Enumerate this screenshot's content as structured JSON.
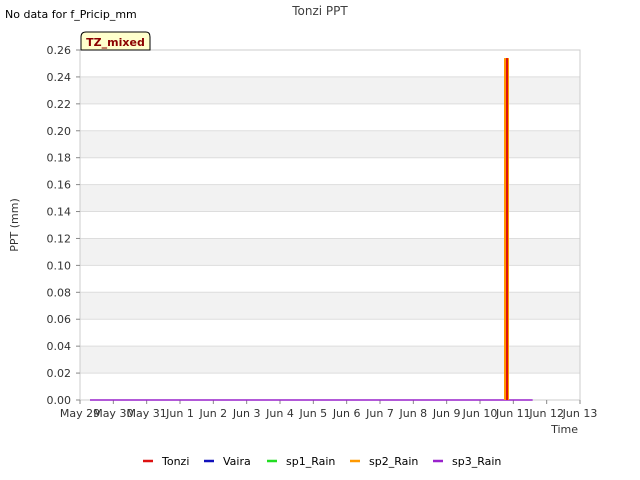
{
  "no_data_text": "No data for f_Pricip_mm",
  "chart_data": {
    "type": "bar",
    "title": "Tonzi PPT",
    "xlabel": "Time",
    "ylabel": "PPT (mm)",
    "tag": "TZ_mixed",
    "ylim": [
      0,
      0.26
    ],
    "yticks": [
      0.0,
      0.02,
      0.04,
      0.06,
      0.08,
      0.1,
      0.12,
      0.14,
      0.16,
      0.18,
      0.2,
      0.22,
      0.24,
      0.26
    ],
    "x_ticks": [
      "May 29",
      "May 30",
      "May 31",
      "Jun 1",
      "Jun 2",
      "Jun 3",
      "Jun 4",
      "Jun 5",
      "Jun 6",
      "Jun 7",
      "Jun 8",
      "Jun 9",
      "Jun 10",
      "Jun 11",
      "Jun 12",
      "Jun 13"
    ],
    "x_range": [
      "May 29",
      "Jun 13"
    ],
    "grid": true,
    "legend_position": "bottom",
    "series": [
      {
        "name": "Tonzi",
        "color": "#dd1111",
        "points": [
          [
            "Jun 10",
            0.254
          ]
        ]
      },
      {
        "name": "Vaira",
        "color": "#1111bb",
        "points": []
      },
      {
        "name": "sp1_Rain",
        "color": "#22dd22",
        "points": []
      },
      {
        "name": "sp2_Rain",
        "color": "#ff9900",
        "points": [
          [
            "Jun 10",
            0.254
          ]
        ]
      },
      {
        "name": "sp3_Rain",
        "color": "#9922cc",
        "points": [
          [
            "May 29",
            0.0
          ],
          [
            "Jun 12",
            0.0
          ]
        ]
      }
    ]
  }
}
